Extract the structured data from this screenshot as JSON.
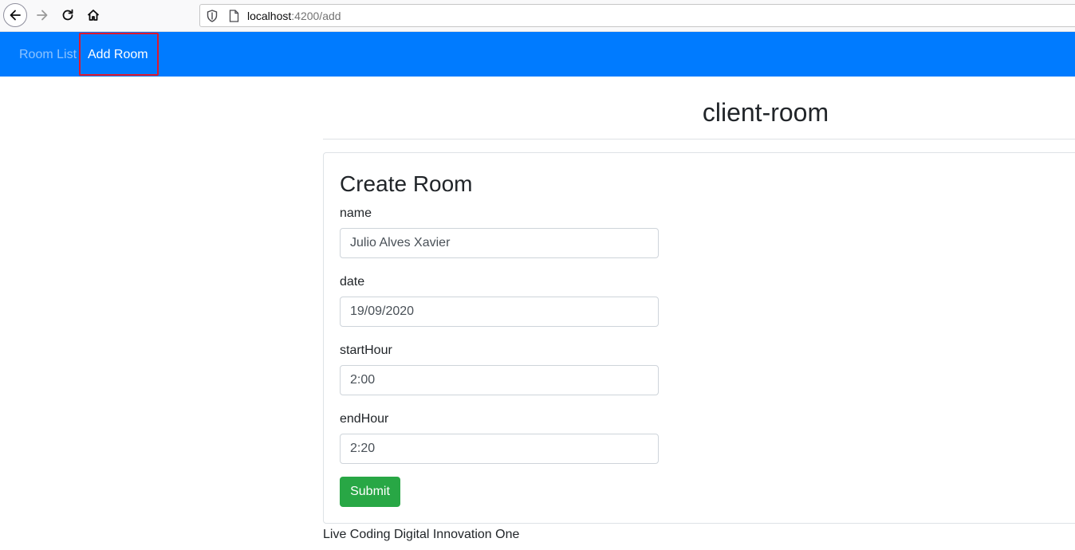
{
  "browser": {
    "url_host": "localhost",
    "url_path": ":4200/add",
    "icons": [
      "back-icon",
      "forward-icon",
      "reload-icon",
      "home-icon",
      "shield-icon",
      "page-icon"
    ]
  },
  "navbar": {
    "color": "#007bff",
    "items": [
      {
        "label": "Room List",
        "active": false
      },
      {
        "label": "Add Room",
        "active": true
      }
    ]
  },
  "page": {
    "title": "client-room"
  },
  "form": {
    "title": "Create Room",
    "fields": [
      {
        "label": "name",
        "value": "Julio Alves Xavier"
      },
      {
        "label": "date",
        "value": "19/09/2020"
      },
      {
        "label": "startHour",
        "value": "2:00"
      },
      {
        "label": "endHour",
        "value": "2:20"
      }
    ],
    "submit_label": "Submit",
    "submit_color": "#28a745"
  },
  "footer": {
    "text": "Live Coding Digital Innovation One"
  }
}
